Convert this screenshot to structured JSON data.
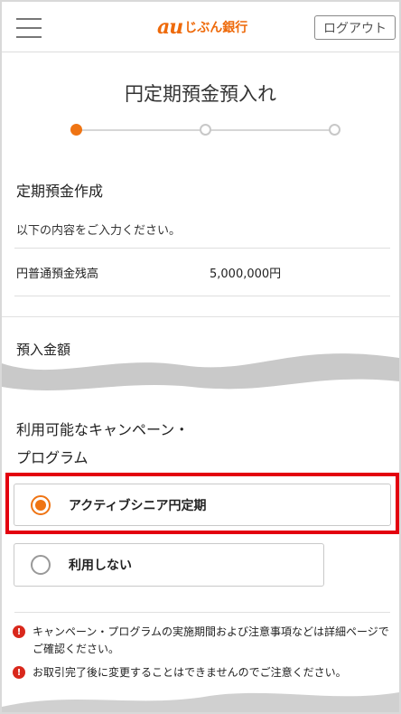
{
  "header": {
    "logo_brand": "au",
    "logo_text": "じぶん銀行",
    "logout_label": "ログアウト",
    "brand_color": "#ee6a0b"
  },
  "page": {
    "title": "円定期預金預入れ"
  },
  "stepper": {
    "current_step": 1,
    "total_steps": 3
  },
  "section": {
    "heading": "定期預金作成",
    "lead": "以下の内容をご入力ください。",
    "balance_label": "円普通預金残高",
    "balance_value": "5,000,000円",
    "deposit_label": "預入金額"
  },
  "campaign": {
    "heading_line1": "利用可能なキャンペーン・",
    "heading_line2": "プログラム",
    "options": [
      {
        "label": "アクティブシニア円定期",
        "selected": true
      },
      {
        "label": "利用しない",
        "selected": false
      }
    ]
  },
  "notes": [
    "キャンペーン・プログラムの実施期間および注意事項などは詳細ページでご確認ください。",
    "お取引完了後に変更することはできませんのでご注意ください。"
  ],
  "colors": {
    "accent": "#ef7413",
    "highlight": "#e3000f",
    "warning": "#d9281c"
  }
}
